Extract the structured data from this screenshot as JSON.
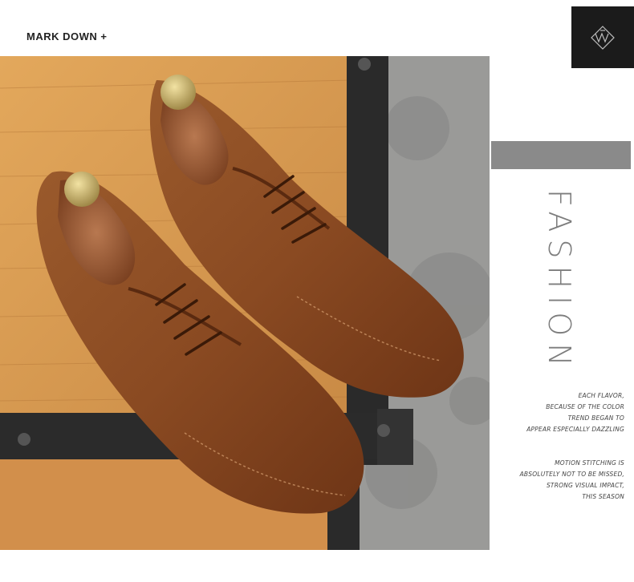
{
  "brand": "MARK DOWN +",
  "side_heading": "FASHION",
  "description_1": [
    "EACH FLAVOR,",
    "BECAUSE OF THE COLOR",
    "TREND BEGAN TO",
    "APPEAR ESPECIALLY DAZZLING"
  ],
  "description_2": [
    "MOTION STITCHING IS",
    "ABSOLUTELY NOT TO BE MISSED,",
    "STRONG VISUAL IMPACT,",
    "THIS SEASON"
  ],
  "logo_icon": "monogram-logo-icon",
  "photo_subject": "pair-of-brown-leather-derby-shoes-icon",
  "colors": {
    "leather": "#8a4a22",
    "wood": "#d99a50",
    "frame": "#2a2a2a",
    "floor": "#9a9a98",
    "grey_bar": "#8a8a8a"
  }
}
